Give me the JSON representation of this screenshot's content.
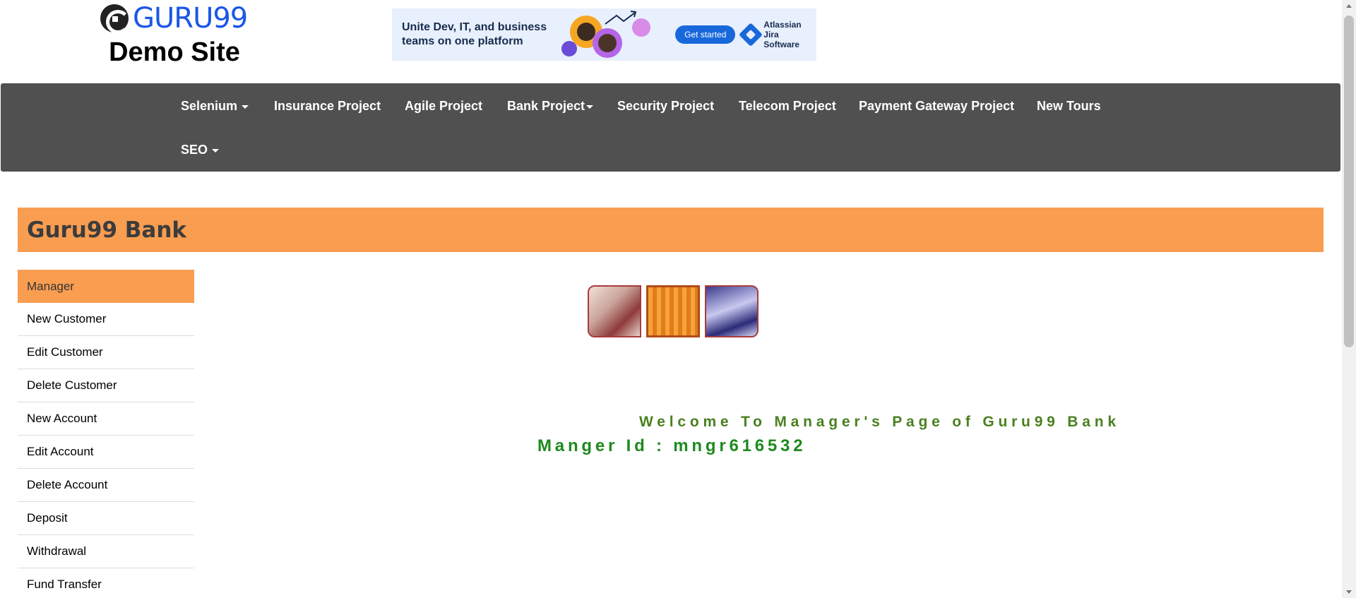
{
  "header": {
    "logo_text": "GURU99",
    "logo_subtitle": "Demo Site"
  },
  "ad": {
    "headline_line1": "Unite Dev, IT, and business",
    "headline_line2": "teams on one platform",
    "cta": "Get started",
    "brand_line1": "Atlassian",
    "brand_line2": "Jira Software"
  },
  "navbar": {
    "items": [
      {
        "label": "Selenium",
        "dropdown": true
      },
      {
        "label": "Insurance Project",
        "dropdown": false
      },
      {
        "label": "Agile Project",
        "dropdown": false
      },
      {
        "label": "Bank Project",
        "dropdown": true
      },
      {
        "label": "Security Project",
        "dropdown": false
      },
      {
        "label": "Telecom Project",
        "dropdown": false
      },
      {
        "label": "Payment Gateway Project",
        "dropdown": false
      },
      {
        "label": "New Tours",
        "dropdown": false
      },
      {
        "label": "SEO",
        "dropdown": true
      }
    ]
  },
  "bank": {
    "title": "Guru99 Bank"
  },
  "sidebar": {
    "items": [
      {
        "label": "Manager",
        "active": true
      },
      {
        "label": "New Customer",
        "active": false
      },
      {
        "label": "Edit Customer",
        "active": false
      },
      {
        "label": "Delete Customer",
        "active": false
      },
      {
        "label": "New Account",
        "active": false
      },
      {
        "label": "Edit Account",
        "active": false
      },
      {
        "label": "Delete Account",
        "active": false
      },
      {
        "label": "Deposit",
        "active": false
      },
      {
        "label": "Withdrawal",
        "active": false
      },
      {
        "label": "Fund Transfer",
        "active": false
      }
    ]
  },
  "main": {
    "welcome": "Welcome To Manager's Page of Guru99 Bank",
    "manager_id": "Manger Id : mngr616532"
  },
  "colors": {
    "nav_bg": "#505050",
    "accent_orange": "#f99d51",
    "welcome_green": "#4a8020",
    "id_green": "#1e8a1e",
    "logo_blue": "#1a56e8"
  }
}
